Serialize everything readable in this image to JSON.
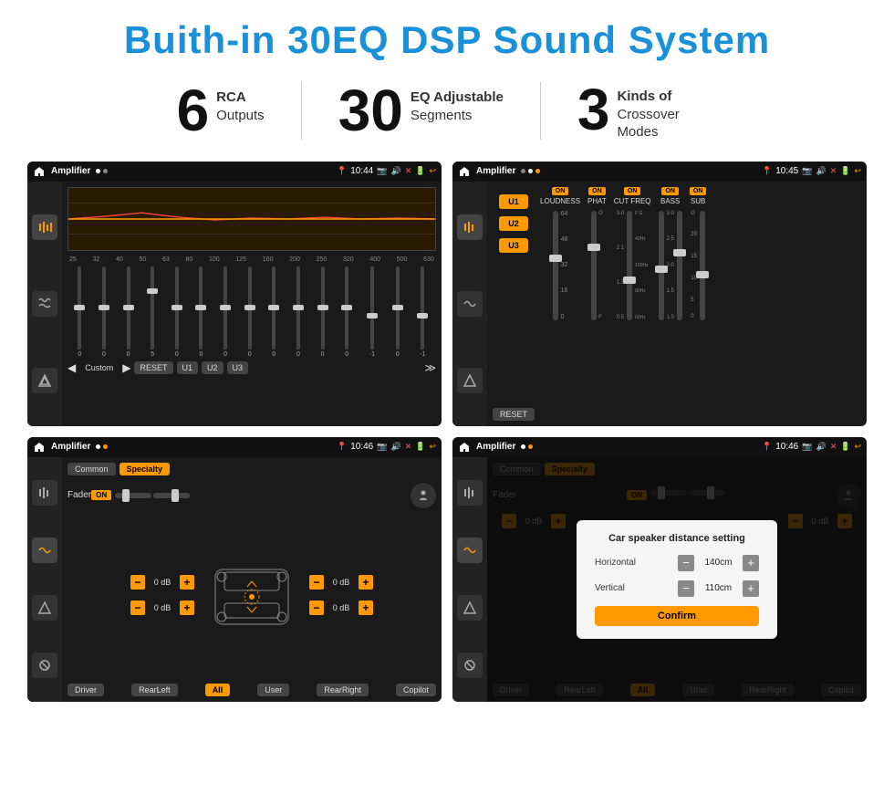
{
  "page": {
    "title": "Buith-in 30EQ DSP Sound System",
    "background": "#ffffff"
  },
  "stats": [
    {
      "number": "6",
      "label_line1": "RCA",
      "label_line2": "Outputs"
    },
    {
      "number": "30",
      "label_line1": "EQ Adjustable",
      "label_line2": "Segments"
    },
    {
      "number": "3",
      "label_line1": "Kinds of",
      "label_line2": "Crossover Modes"
    }
  ],
  "screens": {
    "screen1": {
      "app_name": "Amplifier",
      "time": "10:44",
      "eq_bands": [
        "25",
        "32",
        "40",
        "50",
        "63",
        "80",
        "100",
        "125",
        "160",
        "200",
        "250",
        "320",
        "400",
        "500",
        "630"
      ],
      "eq_values": [
        "0",
        "0",
        "0",
        "5",
        "0",
        "0",
        "0",
        "0",
        "0",
        "0",
        "0",
        "0",
        "-1",
        "0",
        "-1"
      ],
      "preset_label": "Custom",
      "buttons": [
        "RESET",
        "U1",
        "U2",
        "U3"
      ]
    },
    "screen2": {
      "app_name": "Amplifier",
      "time": "10:45",
      "presets": [
        "U1",
        "U2",
        "U3"
      ],
      "controls": [
        "LOUDNESS",
        "PHAT",
        "CUT FREQ",
        "BASS",
        "SUB"
      ],
      "reset_label": "RESET"
    },
    "screen3": {
      "app_name": "Amplifier",
      "time": "10:46",
      "tabs": [
        "Common",
        "Specialty"
      ],
      "fader_label": "Fader",
      "on_label": "ON",
      "db_values": [
        "0 dB",
        "0 dB",
        "0 dB",
        "0 dB"
      ],
      "bottom_btns": [
        "Driver",
        "RearLeft",
        "All",
        "User",
        "RearRight",
        "Copilot"
      ]
    },
    "screen4": {
      "app_name": "Amplifier",
      "time": "10:46",
      "tabs": [
        "Common",
        "Specialty"
      ],
      "modal": {
        "title": "Car speaker distance setting",
        "horizontal_label": "Horizontal",
        "horizontal_value": "140cm",
        "vertical_label": "Vertical",
        "vertical_value": "110cm",
        "confirm_label": "Confirm"
      },
      "bottom_btns": [
        "Driver",
        "RearLeft",
        "All",
        "User",
        "RearRight",
        "Copilot"
      ]
    }
  }
}
